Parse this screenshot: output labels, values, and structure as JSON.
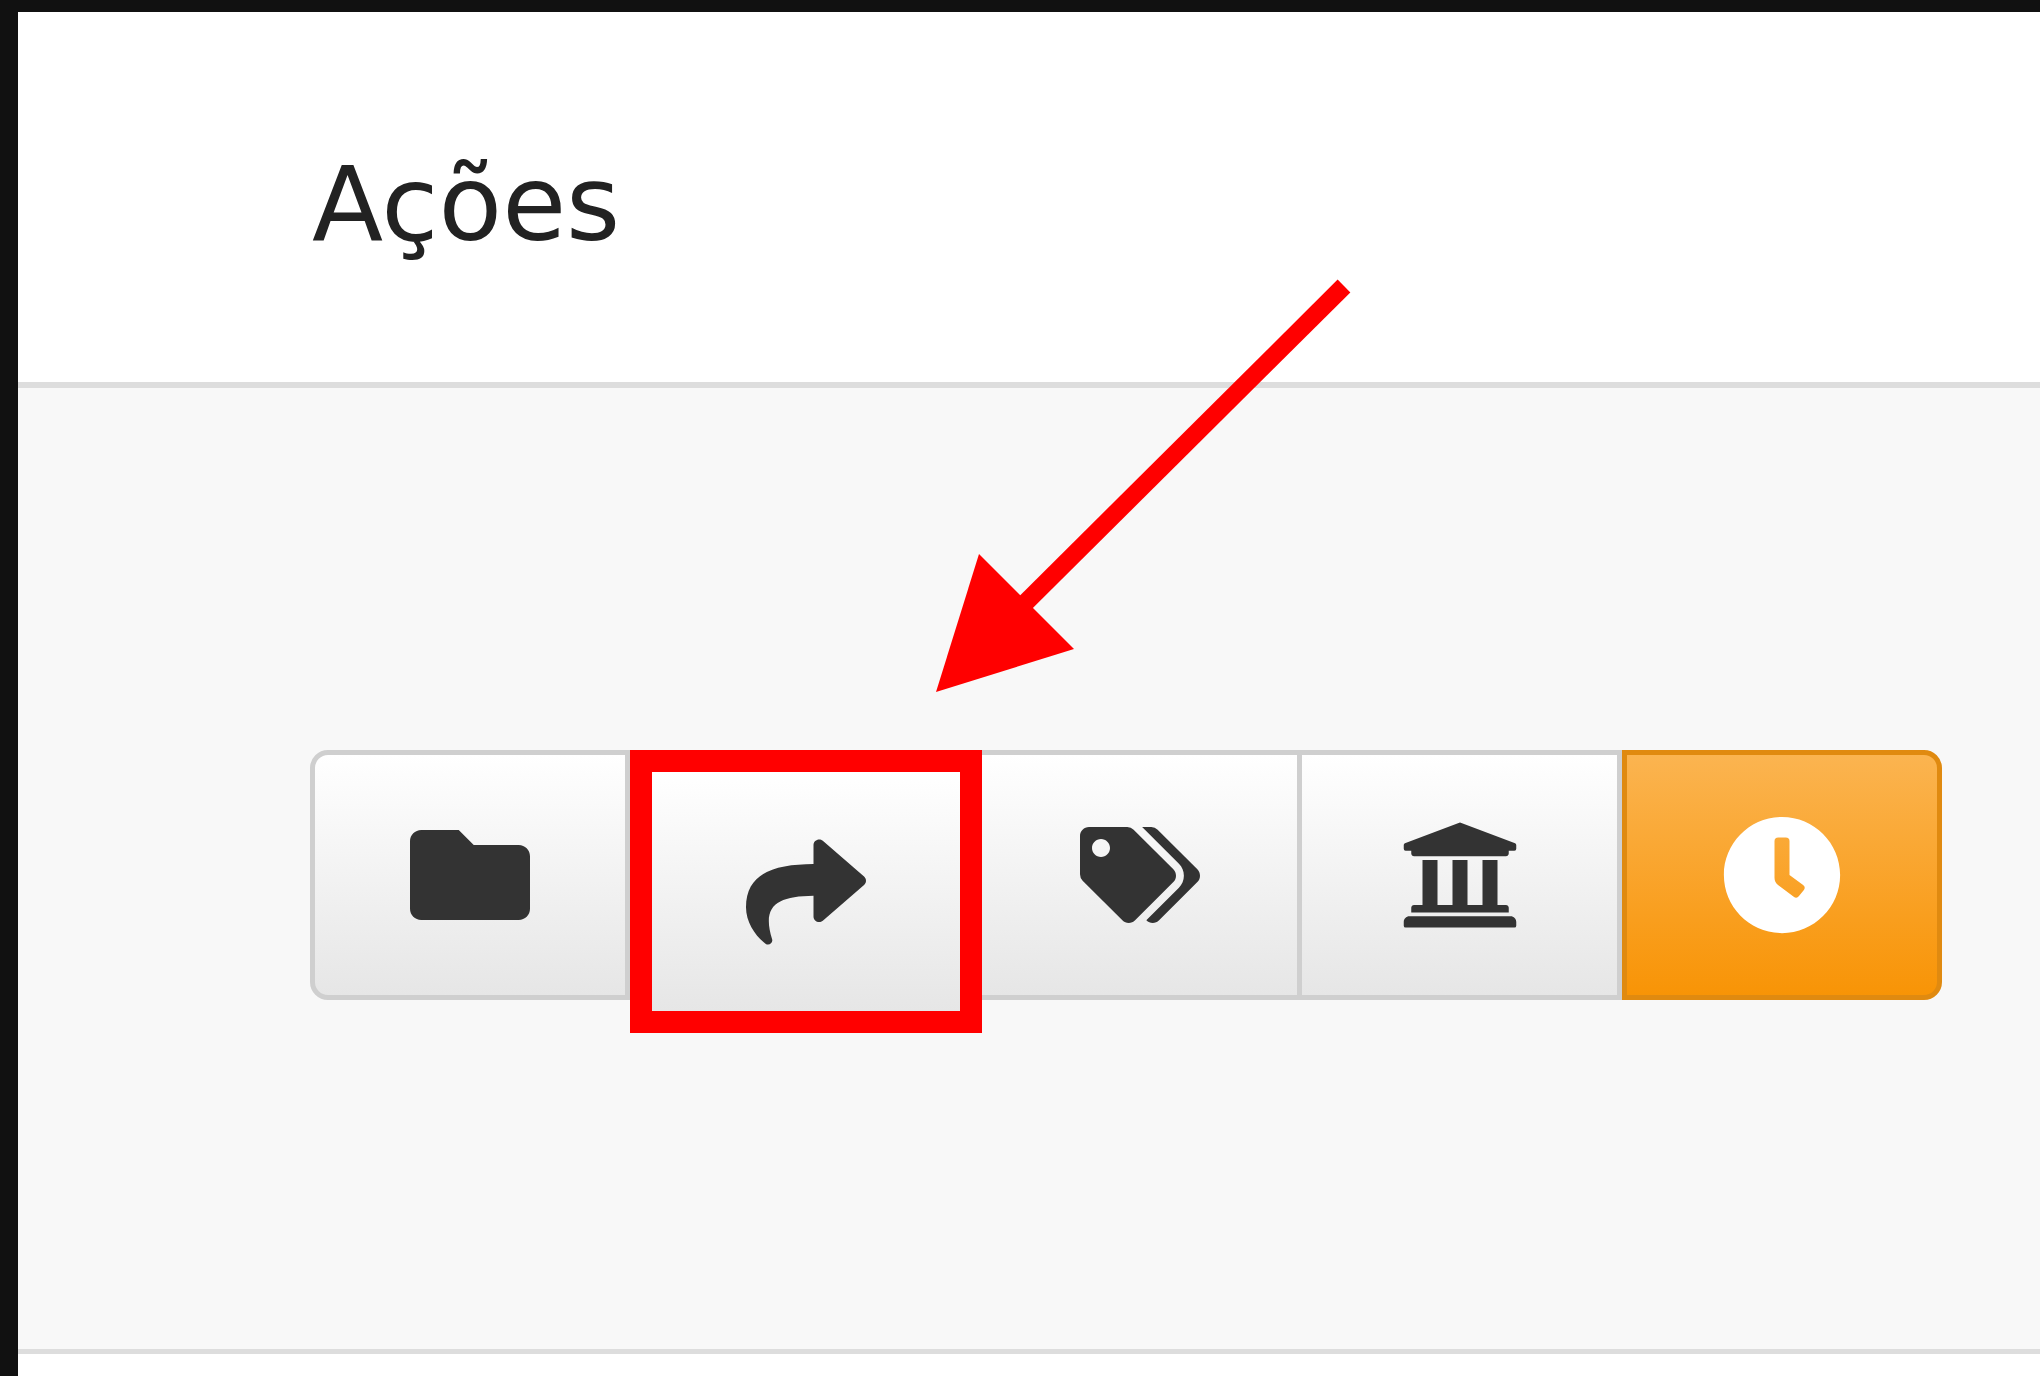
{
  "panel": {
    "title": "Ações"
  },
  "actions": [
    {
      "kind": "default",
      "highlighted": false
    },
    {
      "kind": "default",
      "highlighted": true
    },
    {
      "kind": "default",
      "highlighted": false
    },
    {
      "kind": "default",
      "highlighted": false
    },
    {
      "kind": "warning",
      "highlighted": false
    }
  ]
}
